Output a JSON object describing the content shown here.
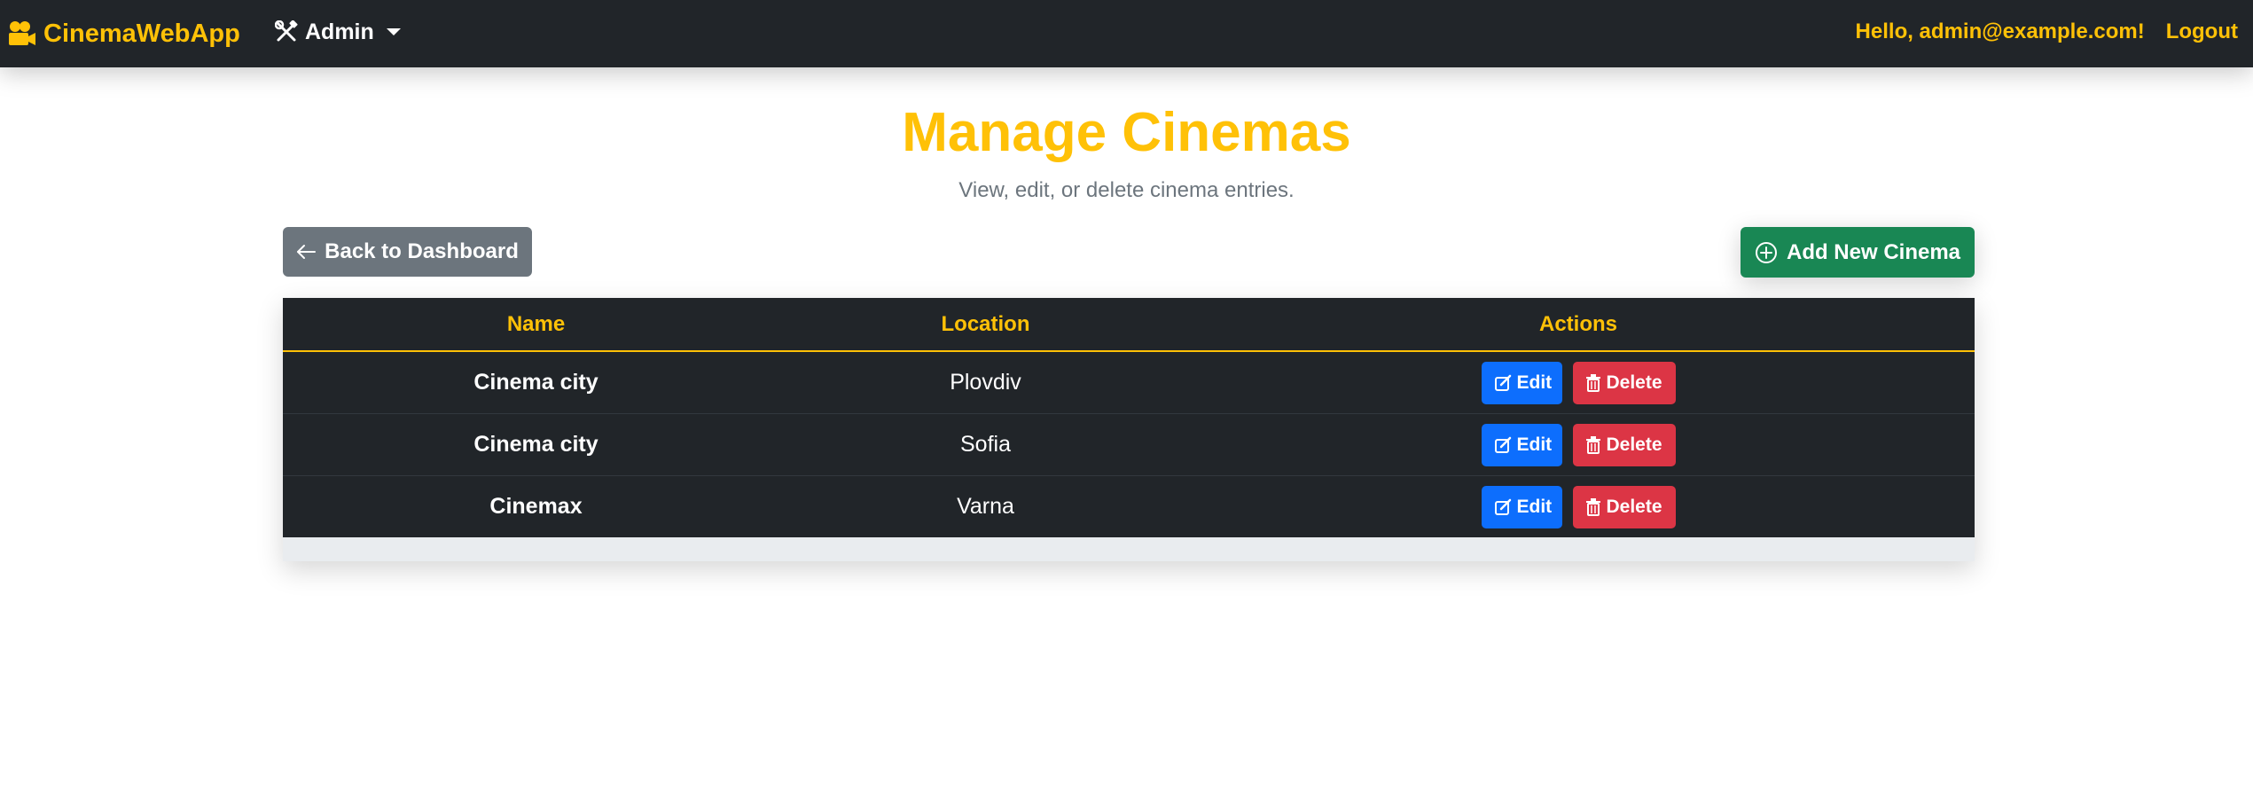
{
  "navbar": {
    "brand": "CinemaWebApp",
    "brand_icon": "camera-reels-icon",
    "admin_label": "Admin",
    "admin_icon": "tools-icon",
    "greeting": "Hello, admin@example.com!",
    "logout_label": "Logout"
  },
  "header": {
    "title": "Manage Cinemas",
    "subtitle": "View, edit, or delete cinema entries."
  },
  "toolbar": {
    "back_label": "Back to Dashboard",
    "back_icon": "arrow-left-icon",
    "add_label": "Add New Cinema",
    "add_icon": "plus-circle-icon"
  },
  "table": {
    "columns": [
      "Name",
      "Location",
      "Actions"
    ],
    "rows": [
      {
        "name": "Cinema city",
        "location": "Plovdiv"
      },
      {
        "name": "Cinema city",
        "location": "Sofia"
      },
      {
        "name": "Cinemax",
        "location": "Varna"
      }
    ],
    "edit_label": "Edit",
    "delete_label": "Delete",
    "edit_icon": "pencil-square-icon",
    "delete_icon": "trash-icon"
  },
  "colors": {
    "accent": "#ffc107",
    "navbar_bg": "#212529",
    "secondary": "#6c757d",
    "success": "#198754",
    "primary": "#0d6efd",
    "danger": "#dc3545"
  }
}
